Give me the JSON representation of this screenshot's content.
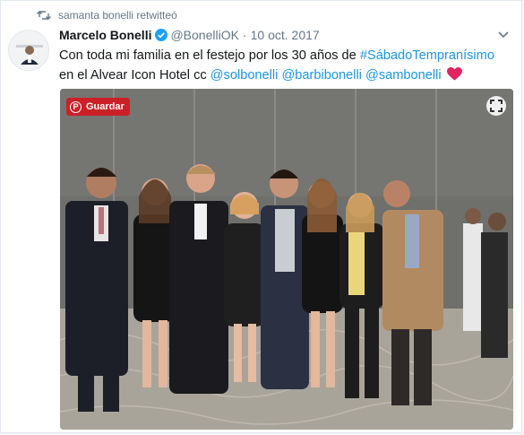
{
  "retweet": {
    "text": "samanta bonelli retwitteó",
    "icon": "retweet-icon"
  },
  "author": {
    "name": "Marcelo Bonelli",
    "handle": "@BonelliOK",
    "separator": "·",
    "date": "10 oct. 2017",
    "verified_icon": "verified-badge-icon",
    "avatar_icon": "avatar-image"
  },
  "tweet": {
    "text_before_hashtag": "Con toda mi familia en el festejo por los 30 años de ",
    "hashtag": "#SábadoTempranísimo",
    "text_after_hashtag": " en el Alvear Icon Hotel cc ",
    "mention_1": "@solbonelli",
    "mention_2": "@barbibonelli",
    "mention_3": "@sambonelli",
    "emoji": "red-heart-icon"
  },
  "media": {
    "pin_label": "Guardar",
    "pin_icon": "pinterest-icon",
    "expand_icon": "expand-icon"
  },
  "colors": {
    "link": "#1b95e0",
    "pinterest": "#cb2027",
    "heart": "#e0245e",
    "verified": "#1da1f2"
  }
}
